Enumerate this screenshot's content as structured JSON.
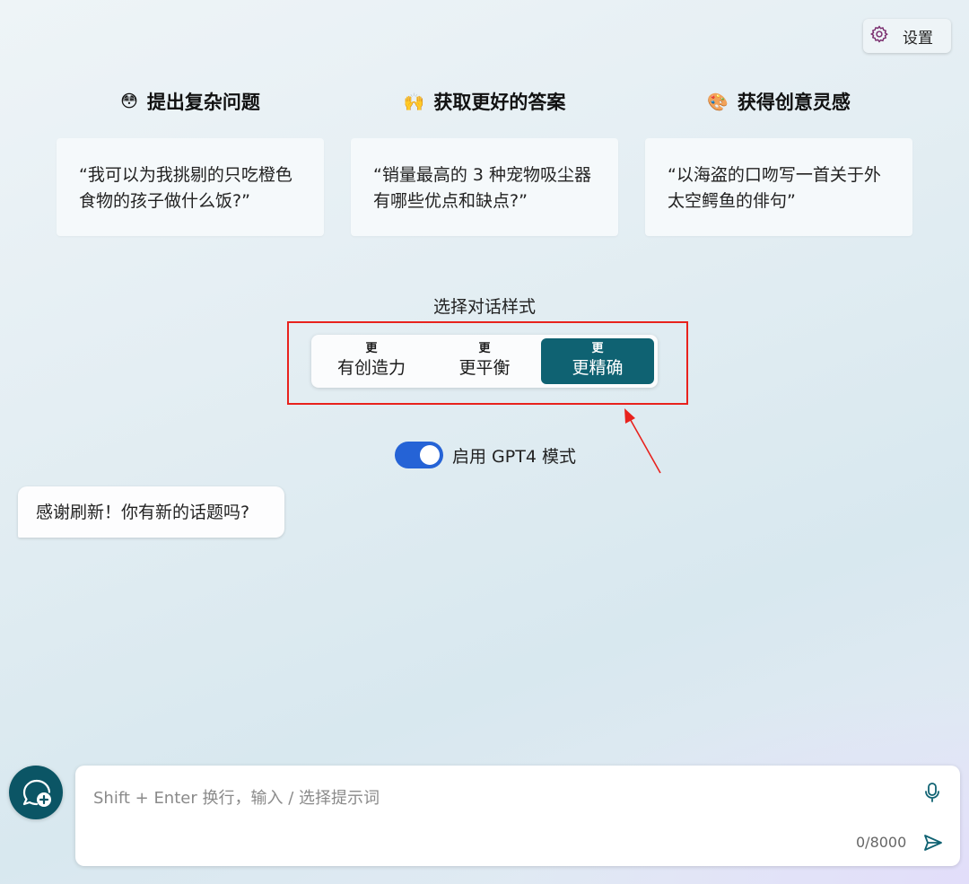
{
  "settings": {
    "label": "设置",
    "icon": "gear-icon"
  },
  "features": [
    {
      "emoji": "😳",
      "icon": "flushed-face-icon",
      "title": "提出复杂问题",
      "example": "“我可以为我挑剔的只吃橙色食物的孩子做什么饭?”"
    },
    {
      "emoji": "🙌",
      "icon": "raising-hands-icon",
      "title": "获取更好的答案",
      "example": "“销量最高的 3 种宠物吸尘器有哪些优点和缺点?”"
    },
    {
      "emoji": "🎨",
      "icon": "palette-icon",
      "title": "获得创意灵感",
      "example": "“以海盗的口吻写一首关于外太空鳄鱼的俳句”"
    }
  ],
  "conversation_style": {
    "title": "选择对话样式",
    "options": [
      {
        "top": "更",
        "bottom": "有创造力"
      },
      {
        "top": "更",
        "bottom": "更平衡"
      },
      {
        "top": "更",
        "bottom": "更精确"
      }
    ],
    "selected": "更精确"
  },
  "gpt4_toggle": {
    "label": "启用 GPT4 模式",
    "enabled": true
  },
  "bot_message": "感谢刷新！你有新的话题吗?",
  "input": {
    "placeholder": "Shift + Enter 换行，输入 / 选择提示词",
    "counter": "0/8000",
    "icons": [
      "microphone-icon",
      "send-icon"
    ]
  },
  "new_topic_icon": "new-topic-icon",
  "colors": {
    "accent": "#0f6272",
    "toggle": "#2563d6",
    "highlight": "#e8221d"
  }
}
